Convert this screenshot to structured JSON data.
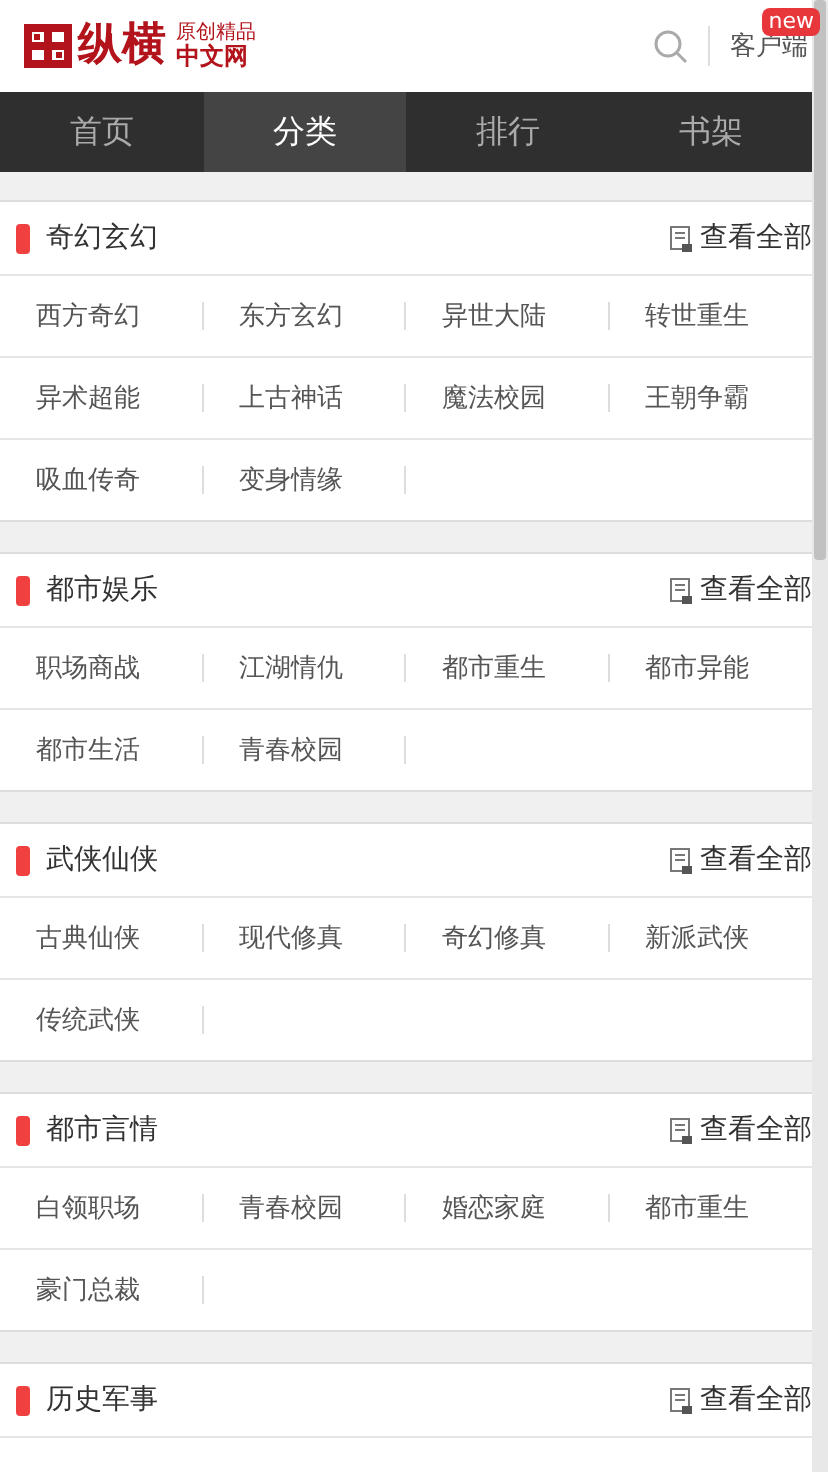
{
  "header": {
    "logo_main": "纵横",
    "logo_top": "原创精品",
    "logo_bottom": "中文网",
    "client_label": "客户端",
    "badge": "new"
  },
  "tabs": [
    {
      "label": "首页",
      "selected": false
    },
    {
      "label": "分类",
      "selected": true
    },
    {
      "label": "排行",
      "selected": false
    },
    {
      "label": "书架",
      "selected": false
    }
  ],
  "sections": [
    {
      "title": "奇幻玄幻",
      "more": "查看全部",
      "items": [
        "西方奇幻",
        "东方玄幻",
        "异世大陆",
        "转世重生",
        "异术超能",
        "上古神话",
        "魔法校园",
        "王朝争霸",
        "吸血传奇",
        "变身情缘"
      ]
    },
    {
      "title": "都市娱乐",
      "more": "查看全部",
      "items": [
        "职场商战",
        "江湖情仇",
        "都市重生",
        "都市异能",
        "都市生活",
        "青春校园"
      ]
    },
    {
      "title": "武侠仙侠",
      "more": "查看全部",
      "items": [
        "古典仙侠",
        "现代修真",
        "奇幻修真",
        "新派武侠",
        "传统武侠"
      ]
    },
    {
      "title": "都市言情",
      "more": "查看全部",
      "items": [
        "白领职场",
        "青春校园",
        "婚恋家庭",
        "都市重生",
        "豪门总裁"
      ]
    },
    {
      "title": "历史军事",
      "more": "查看全部"
    }
  ]
}
